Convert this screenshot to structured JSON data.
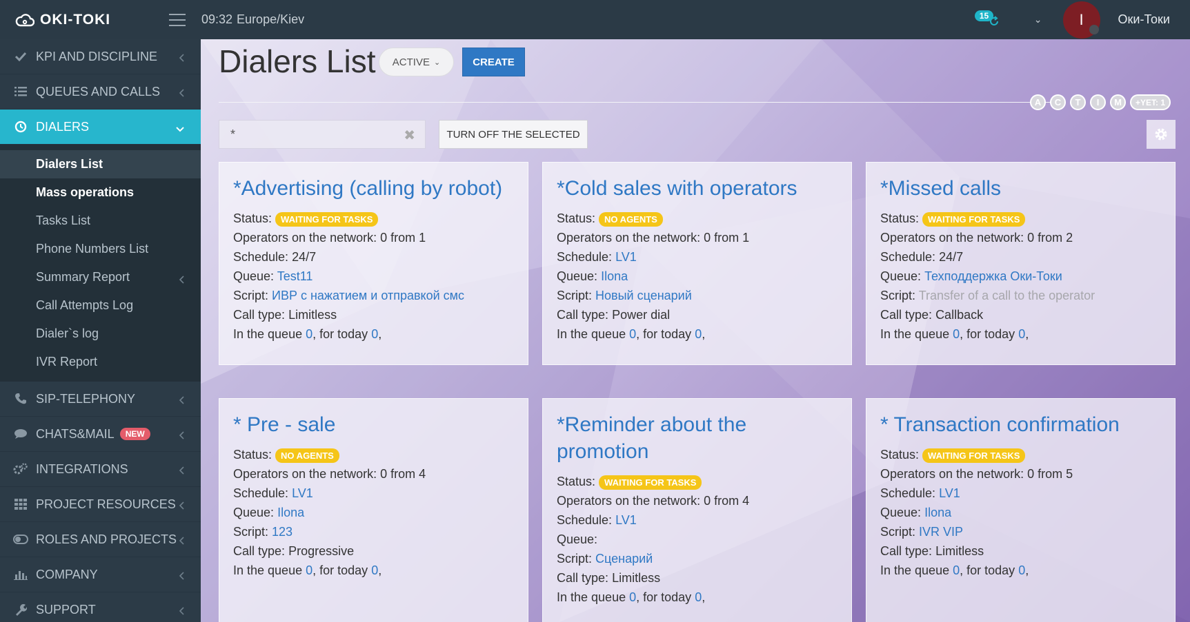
{
  "app": {
    "logo": "OKI-TOKI",
    "time": "09:32",
    "timezone": "Europe/Kiev",
    "notifications": "15",
    "avatar_initial": "I",
    "username": "Оки-Токи"
  },
  "sidebar": {
    "items_top": [
      {
        "label": "KPI AND DISCIPLINE",
        "icon": "check-icon"
      },
      {
        "label": "QUEUES AND CALLS",
        "icon": "list-icon"
      }
    ],
    "active": {
      "label": "DIALERS",
      "icon": "dialer-icon"
    },
    "sub": [
      {
        "label": "Dialers List"
      },
      {
        "label": "Mass operations"
      },
      {
        "label": "Tasks List"
      },
      {
        "label": "Phone Numbers List"
      },
      {
        "label": "Summary Report"
      },
      {
        "label": "Call Attempts Log"
      },
      {
        "label": "Dialer`s log"
      },
      {
        "label": "IVR Report"
      }
    ],
    "items_bottom": [
      {
        "label": "SIP-TELEPHONY",
        "icon": "phone-icon"
      },
      {
        "label": "CHATS&MAIL",
        "icon": "chat-icon",
        "badge": "NEW"
      },
      {
        "label": "INTEGRATIONS",
        "icon": "cogs-icon"
      },
      {
        "label": "PROJECT RESOURCES",
        "icon": "grid-icon"
      },
      {
        "label": "ROLES AND PROJECTS",
        "icon": "toggle-icon"
      },
      {
        "label": "COMPANY",
        "icon": "bar-chart-icon"
      },
      {
        "label": "SUPPORT",
        "icon": "wrench-icon"
      }
    ]
  },
  "main": {
    "title": "Dialers List",
    "filter_label": "ACTIVE",
    "create_label": "CREATE",
    "letters": [
      "A",
      "C",
      "T",
      "I",
      "M"
    ],
    "yet_label": "+YET: 1",
    "search_value": "*",
    "turnoff_label": "TURN OFF THE SELECTED",
    "labels": {
      "status": "Status:",
      "operators": "Operators on the network:",
      "schedule": "Schedule:",
      "queue": "Queue:",
      "script": "Script:",
      "calltype": "Call type:",
      "in_queue": "In the queue",
      "for_today": ", for today"
    },
    "cards": [
      {
        "title": "*Advertising (calling by robot)",
        "status": "WAITING FOR TASKS",
        "operators": "0 from 1",
        "schedule": "24/7",
        "queue": "Test11",
        "script": "ИВР с нажатием и отправкой смс",
        "calltype": "Limitless",
        "in_queue": "0",
        "today": "0"
      },
      {
        "title": "*Cold sales with operators",
        "status": "NO AGENTS",
        "operators": "0 from 1",
        "schedule": "LV1",
        "queue": "Ilona",
        "script": "Новый сценарий",
        "calltype": "Power dial",
        "in_queue": "0",
        "today": "0"
      },
      {
        "title": "*Missed calls",
        "status": "WAITING FOR TASKS",
        "operators": "0 from 2",
        "schedule": "24/7",
        "queue": "Техподдержка Оки-Токи",
        "script": "Transfer of a call to the operator",
        "calltype": "Callback",
        "in_queue": "0",
        "today": "0"
      },
      {
        "title": "* Pre - sale",
        "status": "NO AGENTS",
        "operators": "0 from 4",
        "schedule": "LV1",
        "queue": "Ilona",
        "script": "123",
        "calltype": "Progressive",
        "in_queue": "0",
        "today": "0"
      },
      {
        "title": "*Reminder about the promotion",
        "status": "WAITING FOR TASKS",
        "operators": "0 from 4",
        "schedule": "LV1",
        "queue": "",
        "script": "Сценарий",
        "calltype": "Limitless",
        "in_queue": "0",
        "today": "0"
      },
      {
        "title": "* Transaction confirmation",
        "status": "WAITING FOR TASKS",
        "operators": "0 from 5",
        "schedule": "LV1",
        "queue": "Ilona",
        "script": "IVR VIP",
        "calltype": "Limitless",
        "in_queue": "0",
        "today": "0"
      }
    ]
  }
}
